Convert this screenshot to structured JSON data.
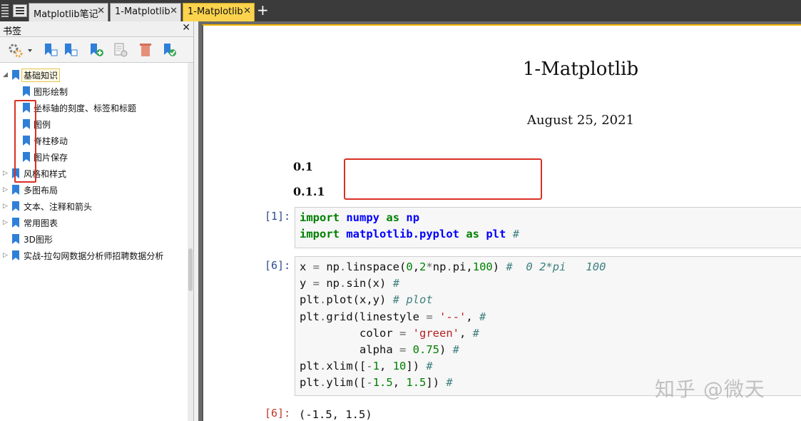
{
  "tabs": [
    {
      "label": "Matplotlib笔记",
      "active": false
    },
    {
      "label": "1-Matplotlib",
      "active": false
    },
    {
      "label": "1-Matplotlib",
      "active": true
    }
  ],
  "tab_close_glyph": "✕",
  "new_tab_glyph": "+",
  "sidebar": {
    "title": "书签",
    "close_glyph": "✕",
    "tree": [
      {
        "label": "基础知识",
        "expanded": true,
        "selected": true,
        "children": [
          {
            "label": "图形绘制"
          },
          {
            "label": "坐标轴的刻度、标签和标题"
          },
          {
            "label": "图例"
          },
          {
            "label": "脊柱移动"
          },
          {
            "label": "图片保存"
          }
        ]
      },
      {
        "label": "风格和样式"
      },
      {
        "label": "多图布局"
      },
      {
        "label": "文本、注释和箭头"
      },
      {
        "label": "常用图表"
      },
      {
        "label": "3D图形"
      },
      {
        "label": "实战-拉勾网数据分析师招聘数据分析"
      }
    ]
  },
  "document": {
    "title": "1-Matplotlib",
    "date": "August 25, 2021",
    "sections": [
      "0.1",
      "0.1.1"
    ],
    "cells": [
      {
        "prompt": "[1]:",
        "lines": [
          "import numpy as np",
          "import matplotlib.pyplot as plt #"
        ]
      },
      {
        "prompt": "[6]:",
        "lines": [
          "x = np.linspace(0,2*np.pi,100) #  0 2*pi   100",
          "y = np.sin(x) #",
          "plt.plot(x,y) # plot",
          "plt.grid(linestyle = '--', #",
          "         color = 'green', #",
          "         alpha = 0.75) #",
          "plt.xlim([-1, 10]) #",
          "plt.ylim([-1.5, 1.5]) #"
        ]
      }
    ],
    "output_prompt": "[6]:",
    "output_text": "(-1.5, 1.5)"
  },
  "watermark": "知乎 @微天",
  "colors": {
    "accent_tab": "#fcd34d",
    "bookmark": "#2f7fd8",
    "highlight_box": "#d93025"
  }
}
